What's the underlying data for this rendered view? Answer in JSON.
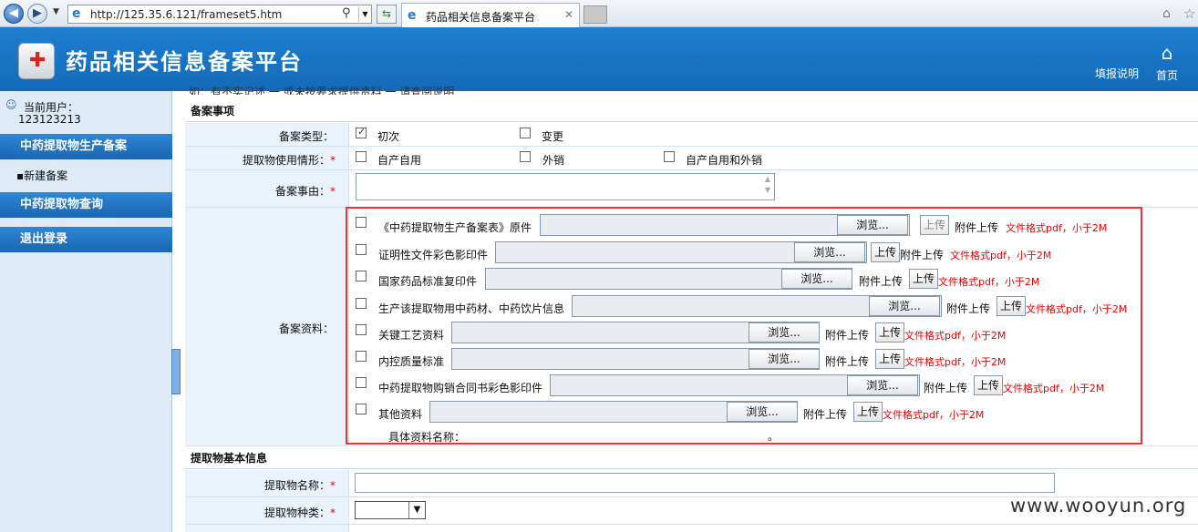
{
  "browser": {
    "url": "http://125.35.6.121/frameset5.htm",
    "tab_title": "药品相关信息备案平台"
  },
  "header": {
    "title": "药品相关信息备案平台",
    "help_link": "填报说明",
    "home_label": "首页"
  },
  "sidebar": {
    "user_label": "当前用户：",
    "user_id": "123123213",
    "menus": [
      {
        "label": "中药提取物生产备案",
        "items": [
          "▪新建备案"
        ]
      },
      {
        "label": "中药提取物查询"
      },
      {
        "label": "退出登录"
      }
    ]
  },
  "form": {
    "top_text": "如：有不实记述 一 或未按要求提供资料 一 请查阅说明",
    "section1": "备案事项",
    "type": {
      "label": "备案类型：",
      "options": [
        {
          "label": "初次",
          "checked": true
        },
        {
          "label": "变更",
          "checked": false
        }
      ]
    },
    "usage": {
      "label": "提取物使用情形：",
      "required": "*",
      "options": [
        "自产自用",
        "外销",
        "自产自用和外销"
      ]
    },
    "reason": {
      "label": "备案事由：",
      "required": "*"
    },
    "materials": {
      "label": "备案资料：",
      "browse": "浏览...",
      "attach": "附件上传",
      "upload": "上传",
      "format": "文件格式pdf，小于2M",
      "items": [
        "《中药提取物生产备案表》原件",
        "证明性文件彩色影印件",
        "国家药品标准复印件",
        "生产该提取物用中药材、中药饮片信息",
        "关键工艺资料",
        "内控质量标准",
        "中药提取物购销合同书彩色影印件",
        "其他资料"
      ],
      "other_name_label": "具体资料名称：",
      "other_name_end": "。"
    },
    "section2": "提取物基本信息",
    "name": {
      "label": "提取物名称：",
      "required": "*"
    },
    "kind": {
      "label": "提取物种类：",
      "required": "*"
    }
  },
  "watermark": "www.wooyun.org"
}
